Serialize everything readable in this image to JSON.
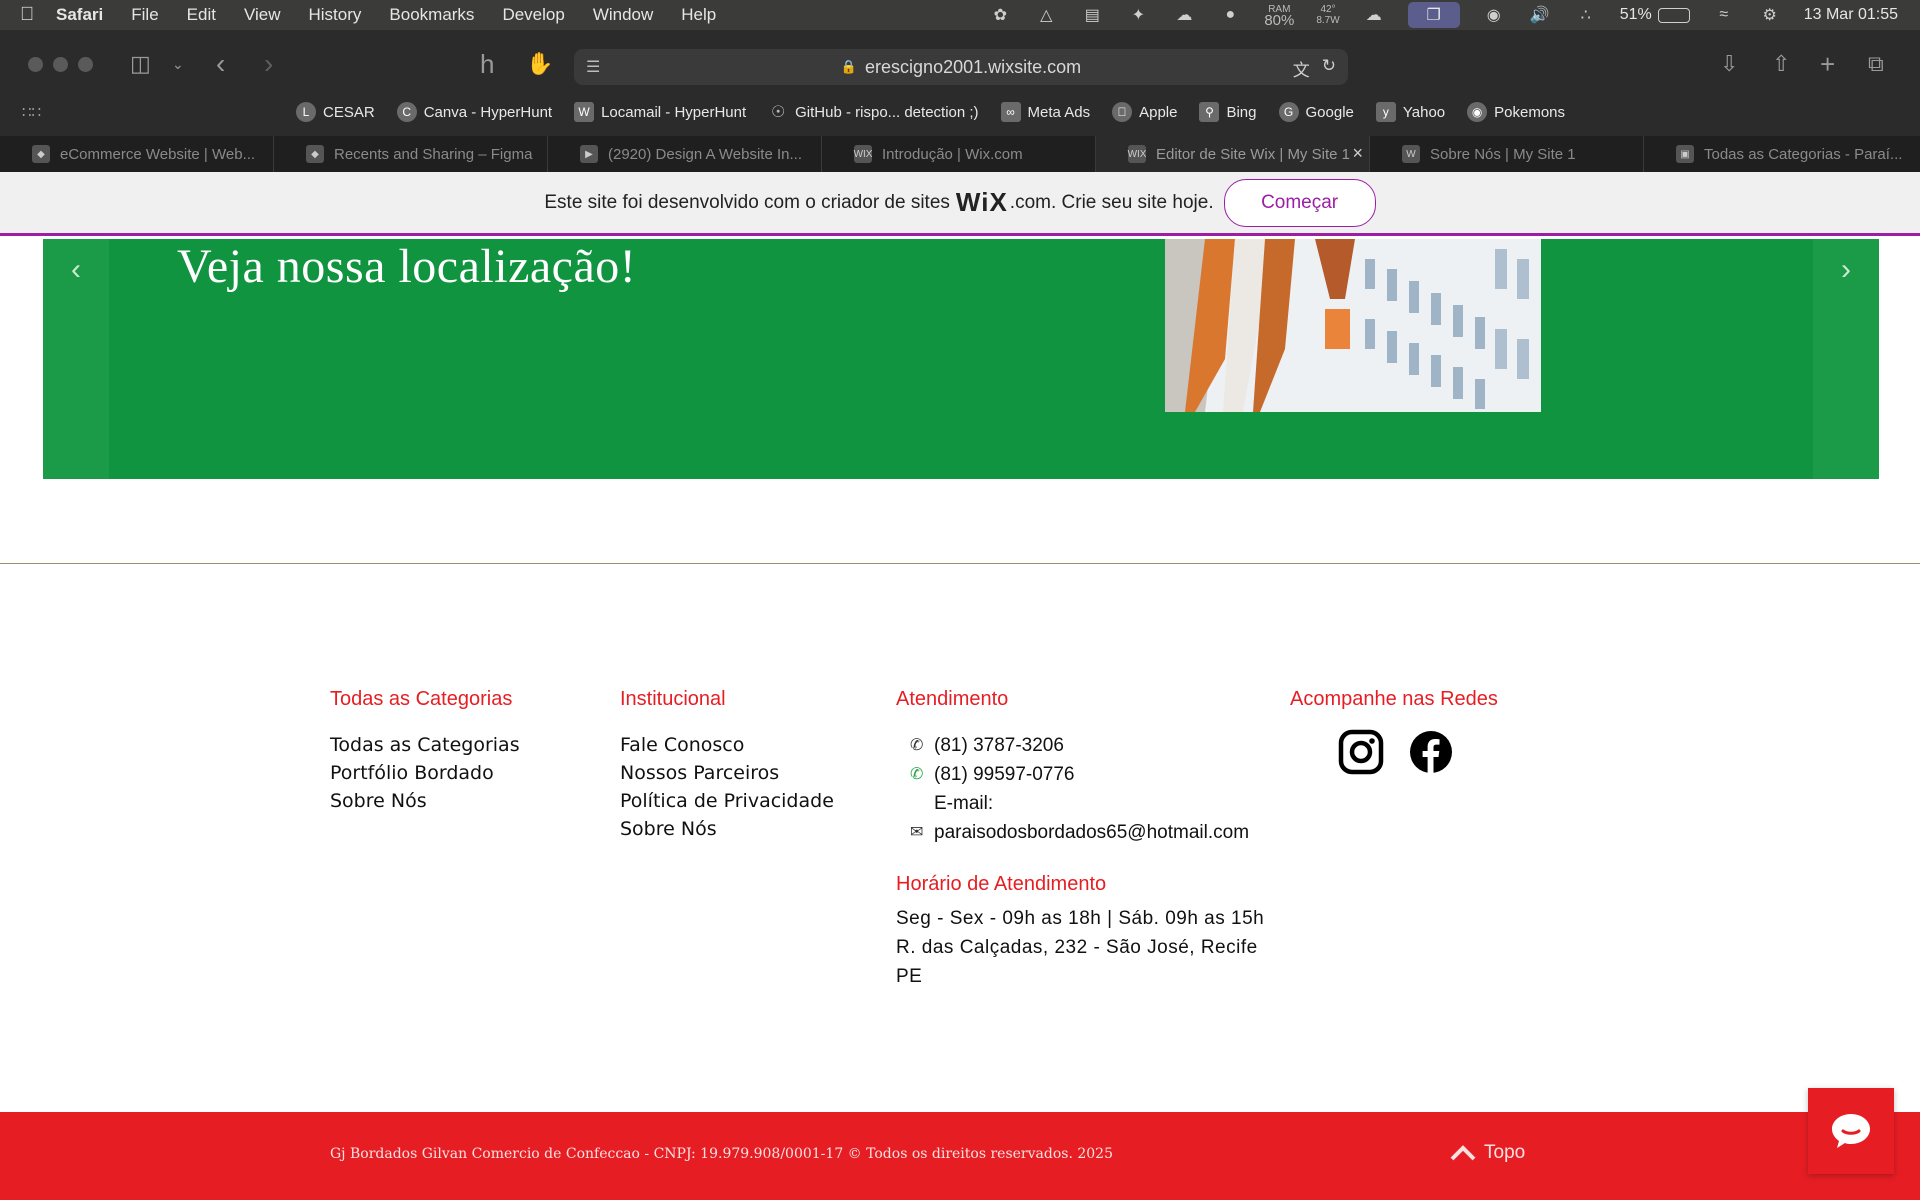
{
  "menubar": {
    "app": "Safari",
    "items": [
      "File",
      "Edit",
      "View",
      "History",
      "Bookmarks",
      "Develop",
      "Window",
      "Help"
    ],
    "ram_label": "RAM",
    "ram_value": "80%",
    "temp": "42°",
    "power": "8.7W",
    "battery": "51%",
    "battery_level": 0.51,
    "clock": "13 Mar  01:55"
  },
  "browser": {
    "url": "erescigno2001.wixsite.com",
    "bookmarks": [
      {
        "label": "CESAR",
        "icon": "L"
      },
      {
        "label": "Canva - HyperHunt",
        "icon": "C"
      },
      {
        "label": "Locamail - HyperHunt",
        "icon": "W"
      },
      {
        "label": "GitHub - rispo... detection ;)",
        "icon": "globe"
      },
      {
        "label": "Meta Ads",
        "icon": "meta"
      },
      {
        "label": "Apple",
        "icon": "apple"
      },
      {
        "label": "Bing",
        "icon": "b"
      },
      {
        "label": "Google",
        "icon": "G"
      },
      {
        "label": "Yahoo",
        "icon": "y"
      },
      {
        "label": "Pokemons",
        "icon": "p"
      }
    ],
    "tabs": [
      {
        "title": "eCommerce Website | Web...",
        "icon": "figma"
      },
      {
        "title": "Recents and Sharing – Figma",
        "icon": "figma"
      },
      {
        "title": "(2920) Design A Website In...",
        "icon": "youtube"
      },
      {
        "title": "Introdução | Wix.com",
        "icon": "wix"
      },
      {
        "title": "Editor de Site Wix | My Site 1",
        "icon": "wix",
        "active": true
      },
      {
        "title": "Sobre Nós | My Site 1",
        "icon": "W"
      },
      {
        "title": "Todas as Categorias - Paraí...",
        "icon": "page"
      }
    ]
  },
  "wix_banner": {
    "text_before": "Este site foi desenvolvido com o criador de sites",
    "logo": "WiX",
    "text_after": ".com. Crie seu site hoje.",
    "button": "Começar"
  },
  "slider": {
    "heading": "Veja nossa localização!"
  },
  "footer": {
    "col1": {
      "title": "Todas as Categorias",
      "links": [
        "Todas as Categorias",
        "Portfólio Bordado",
        "Sobre Nós"
      ]
    },
    "col2": {
      "title": "Institucional",
      "links": [
        "Fale Conosco",
        "Nossos Parceiros",
        "Política de Privacidade",
        "Sobre Nós"
      ]
    },
    "col3": {
      "title": "Atendimento",
      "phone": "(81) 3787-3206",
      "whatsapp": "(81) 99597-0776",
      "email_label": "E-mail:",
      "email": "paraisodosbordados65@hotmail.com",
      "hours_title": "Horário de Atendimento",
      "hours": "Seg - Sex - 09h as 18h | Sáb. 09h as 15h",
      "address_1": "R. das Calçadas, 232 - São José, Recife",
      "address_2": "PE"
    },
    "col4": {
      "title": "Acompanhe nas Redes"
    },
    "copyright": "Gj Bordados Gilvan Comercio de Confeccao - CNPJ: 19.979.908/0001-17 © Todos os direitos reservados. 2025",
    "top_link": "Topo"
  },
  "colors": {
    "accent_red": "#e61e24",
    "slider_green": "#119440",
    "wix_purple": "#9b1ea5"
  }
}
